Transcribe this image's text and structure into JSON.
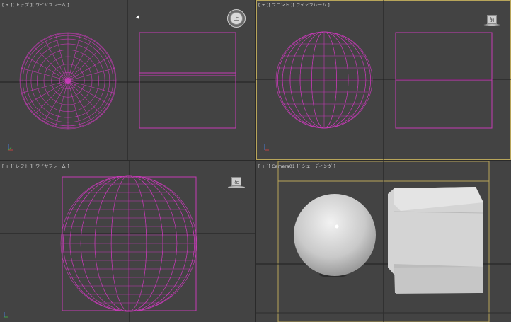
{
  "viewports": {
    "top": {
      "label": "[ + ][ トップ ][ ワイヤフレーム ]",
      "cube": "上"
    },
    "front": {
      "label": "[ + ][ フロント ][ ワイヤフレーム ]",
      "cube": "前"
    },
    "left": {
      "label": "[ + ][ レフト ][ ワイヤフレーム ]",
      "cube": "左"
    },
    "camera": {
      "label": "[ + ][ Camera01 ][ シェーディング ]"
    }
  },
  "colors": {
    "viewport_bg": "#434343",
    "wireframe": "#c43bb5",
    "active_border": "#b8a55a",
    "grid_line": "#1f1f1f"
  }
}
